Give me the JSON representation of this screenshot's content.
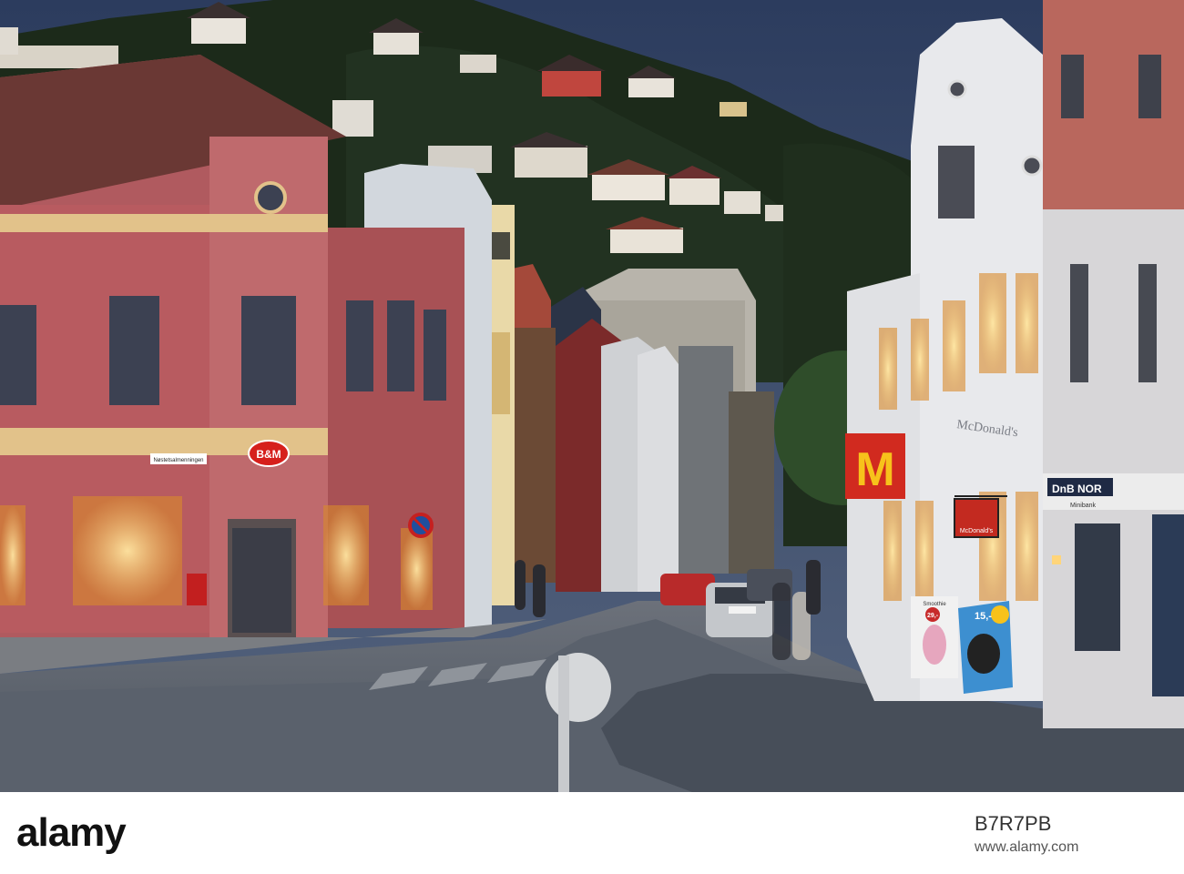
{
  "scene": {
    "description_role": "photo",
    "signs": {
      "bm_store": "B&M",
      "street_sign": "Nøstetsalmenningen",
      "dnb_bank": "DnB NOR",
      "dnb_sub": "Minibank",
      "mcd_building": "McDonald's",
      "mcd_hanging": "McDonald's",
      "mcd_flag": "M",
      "ad_price_1": "29,-",
      "ad_price_2": "15,-",
      "ad_label": "Smoothie"
    }
  },
  "watermark": {
    "logo": "alamy",
    "image_id": "B7R7PB",
    "site": "www.alamy.com"
  },
  "colors": {
    "sky": "#3b4a6b",
    "hill": "#1f2b1c",
    "street": "#5c6470",
    "pink_building": "#b85b60",
    "mcd_red": "#d12a1f",
    "mcd_yellow": "#f7c21b"
  }
}
